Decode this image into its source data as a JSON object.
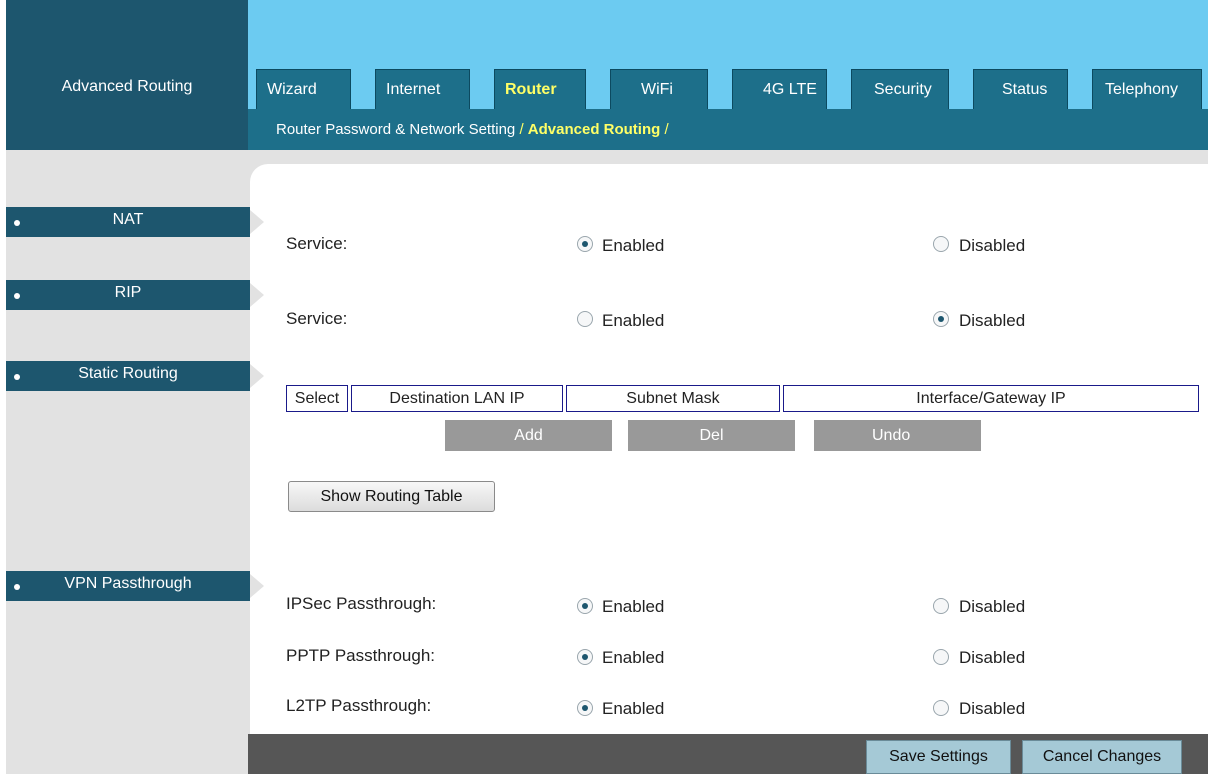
{
  "header": {
    "section_title": "Advanced Routing"
  },
  "tabs": [
    {
      "label": "Wizard"
    },
    {
      "label": "Internet"
    },
    {
      "label": "Router",
      "active": true
    },
    {
      "label": "WiFi"
    },
    {
      "label": "4G LTE"
    },
    {
      "label": "Security"
    },
    {
      "label": "Status"
    },
    {
      "label": "Telephony"
    }
  ],
  "breadcrumb": {
    "item1": "Router Password & Network Setting",
    "sep1": " / ",
    "item2": "Advanced Routing",
    "sep2": " /"
  },
  "sections": {
    "nat": {
      "title": "NAT",
      "service_label": "Service:",
      "enabled_label": "Enabled",
      "disabled_label": "Disabled",
      "selected": "Enabled"
    },
    "rip": {
      "title": "RIP",
      "service_label": "Service:",
      "enabled_label": "Enabled",
      "disabled_label": "Disabled",
      "selected": "Disabled"
    },
    "static_routing": {
      "title": "Static Routing",
      "columns": [
        "Select",
        "Destination LAN IP",
        "Subnet Mask",
        "Interface/Gateway IP"
      ],
      "add_label": "Add",
      "del_label": "Del",
      "undo_label": "Undo",
      "show_table_label": "Show Routing Table"
    },
    "vpn": {
      "title": "VPN Passthrough",
      "rows": [
        {
          "label": "IPSec Passthrough:",
          "enabled_label": "Enabled",
          "disabled_label": "Disabled",
          "selected": "Enabled"
        },
        {
          "label": "PPTP Passthrough:",
          "enabled_label": "Enabled",
          "disabled_label": "Disabled",
          "selected": "Enabled"
        },
        {
          "label": "L2TP Passthrough:",
          "enabled_label": "Enabled",
          "disabled_label": "Disabled",
          "selected": "Enabled"
        }
      ]
    }
  },
  "footer": {
    "save_label": "Save Settings",
    "cancel_label": "Cancel Changes"
  },
  "colors": {
    "brand": "#1d566e",
    "sky": "#6ccbf1",
    "tab": "#1d6f8a",
    "highlight": "#ffff66"
  }
}
